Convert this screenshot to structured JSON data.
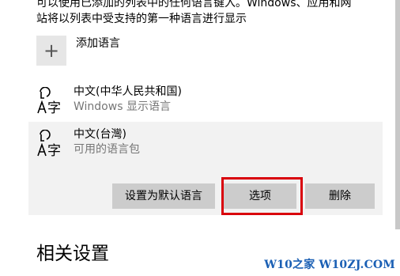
{
  "intro": {
    "line1": "可以使用已添加的列表中的任何语言键入。Windows、应用和网",
    "line2": "站将以列表中受支持的第一种语言进行显示"
  },
  "add_language": {
    "icon": "plus-icon",
    "label": "添加语言"
  },
  "languages": [
    {
      "name": "中文(中华人民共和国)",
      "subtitle": "Windows 显示语言",
      "icon": "language-icon"
    },
    {
      "name": "中文(台灣)",
      "subtitle": "可用的语言包",
      "icon": "language-icon",
      "selected": true
    }
  ],
  "actions": {
    "set_default": "设置为默认语言",
    "options": "选项",
    "remove": "删除"
  },
  "related_settings": {
    "title": "相关设置"
  },
  "watermark": {
    "text": "W10之家 W10ZJ.COM"
  },
  "colors": {
    "highlight": "#d9000b",
    "button_bg": "#cccccc",
    "selected_bg": "#f2f2f2",
    "secondary_text": "#767676"
  }
}
